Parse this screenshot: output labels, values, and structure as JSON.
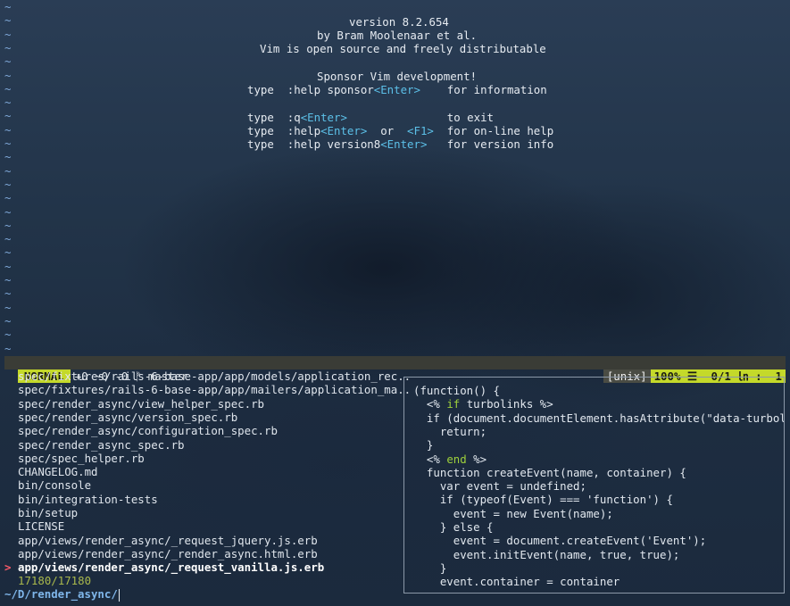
{
  "editor": {
    "tilde_char": "~",
    "intro": {
      "version": "version 8.2.654",
      "author": "by Bram Moolenaar et al.",
      "license": "Vim is open source and freely distributable",
      "sponsor": "Sponsor Vim development!",
      "lines": [
        {
          "a": "type  :help sponsor",
          "b": "<Enter>",
          "c": "    for information"
        },
        {
          "a": "type  :q",
          "b": "<Enter>",
          "c": "               to exit"
        },
        {
          "a": "type  :help",
          "b": "<Enter>",
          "c": "  or  ",
          "d": "<F1>",
          "e": "  for on-line help"
        },
        {
          "a": "type  :help version8",
          "b": "<Enter>",
          "c": "   for version info"
        }
      ]
    }
  },
  "statusline": {
    "mode": "NORMAL",
    "git": "+0 ~0 -0 ᚠ master",
    "fileformat": "[unix]",
    "percent": "100% ☰",
    "position": " 0/1 ㏑ :  1"
  },
  "fzf": {
    "files": [
      "spec/fixtures/rails-6-base-app/app/models/application_rec..",
      "spec/fixtures/rails-6-base-app/app/mailers/application_ma..",
      "spec/render_async/view_helper_spec.rb",
      "spec/render_async/version_spec.rb",
      "spec/render_async/configuration_spec.rb",
      "spec/render_async_spec.rb",
      "spec/spec_helper.rb",
      "CHANGELOG.md",
      "bin/console",
      "bin/integration-tests",
      "bin/setup",
      "LICENSE",
      "app/views/render_async/_request_jquery.js.erb",
      "app/views/render_async/_render_async.html.erb"
    ],
    "selected": "app/views/render_async/_request_vanilla.js.erb",
    "pointer": ">",
    "count": "17180/17180",
    "prompt": "~/D/render_async/"
  },
  "preview": {
    "lines": [
      {
        "t": "(function() {"
      },
      {
        "t": "  <% ",
        "k": "if",
        "r": " turbolinks %>"
      },
      {
        "t": "  if (document.documentElement.hasAttribute(\"data-turboli"
      },
      {
        "t": "    return;"
      },
      {
        "t": "  }"
      },
      {
        "t": "  <% ",
        "k": "end",
        "r": " %>"
      },
      {
        "t": "  function createEvent(name, container) {"
      },
      {
        "t": "    var event = undefined;"
      },
      {
        "t": "    if (typeof(Event) === 'function') {"
      },
      {
        "t": "      event = new Event(name);"
      },
      {
        "t": "    } else {"
      },
      {
        "t": "      event = document.createEvent('Event');"
      },
      {
        "t": "      event.initEvent(name, true, true);"
      },
      {
        "t": "    }"
      },
      {
        "t": "    event.container = container"
      }
    ]
  }
}
